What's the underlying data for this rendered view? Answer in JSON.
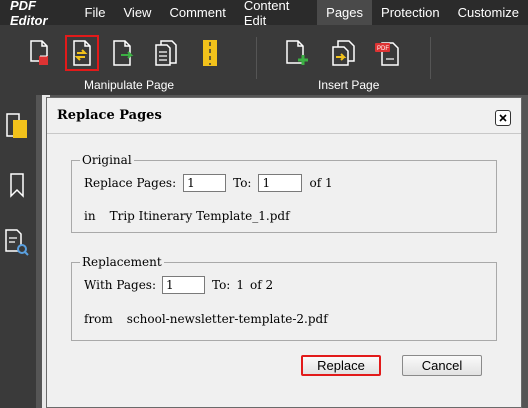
{
  "app": {
    "title": "PDF Editor"
  },
  "menu": [
    "File",
    "View",
    "Comment",
    "Content Edit",
    "Pages",
    "Protection",
    "Customize"
  ],
  "active_menu": "Pages",
  "toolbar": {
    "groups": [
      {
        "label": "Manipulate Page"
      },
      {
        "label": "Insert Page"
      }
    ]
  },
  "dialog": {
    "title": "Replace Pages",
    "original": {
      "legend": "Original",
      "replace_pages_label": "Replace Pages:",
      "from_value": "1",
      "to_label": "To:",
      "to_value": "1",
      "of_text": "of 1",
      "in_label": "in",
      "filename": "Trip Itinerary Template_1.pdf"
    },
    "replacement": {
      "legend": "Replacement",
      "with_pages_label": "With Pages:",
      "with_value": "1",
      "to_label": "To:",
      "to_value": "1",
      "of_text": "of 2",
      "from_label": "from",
      "filename": "school-newsletter-template-2.pdf"
    },
    "replace_button": "Replace",
    "cancel_button": "Cancel"
  },
  "colors": {
    "accent": "#e21a1a",
    "menubar": "#2b2b2b",
    "toolbar": "#3a3a3a",
    "dialog": "#f0f0f0"
  }
}
